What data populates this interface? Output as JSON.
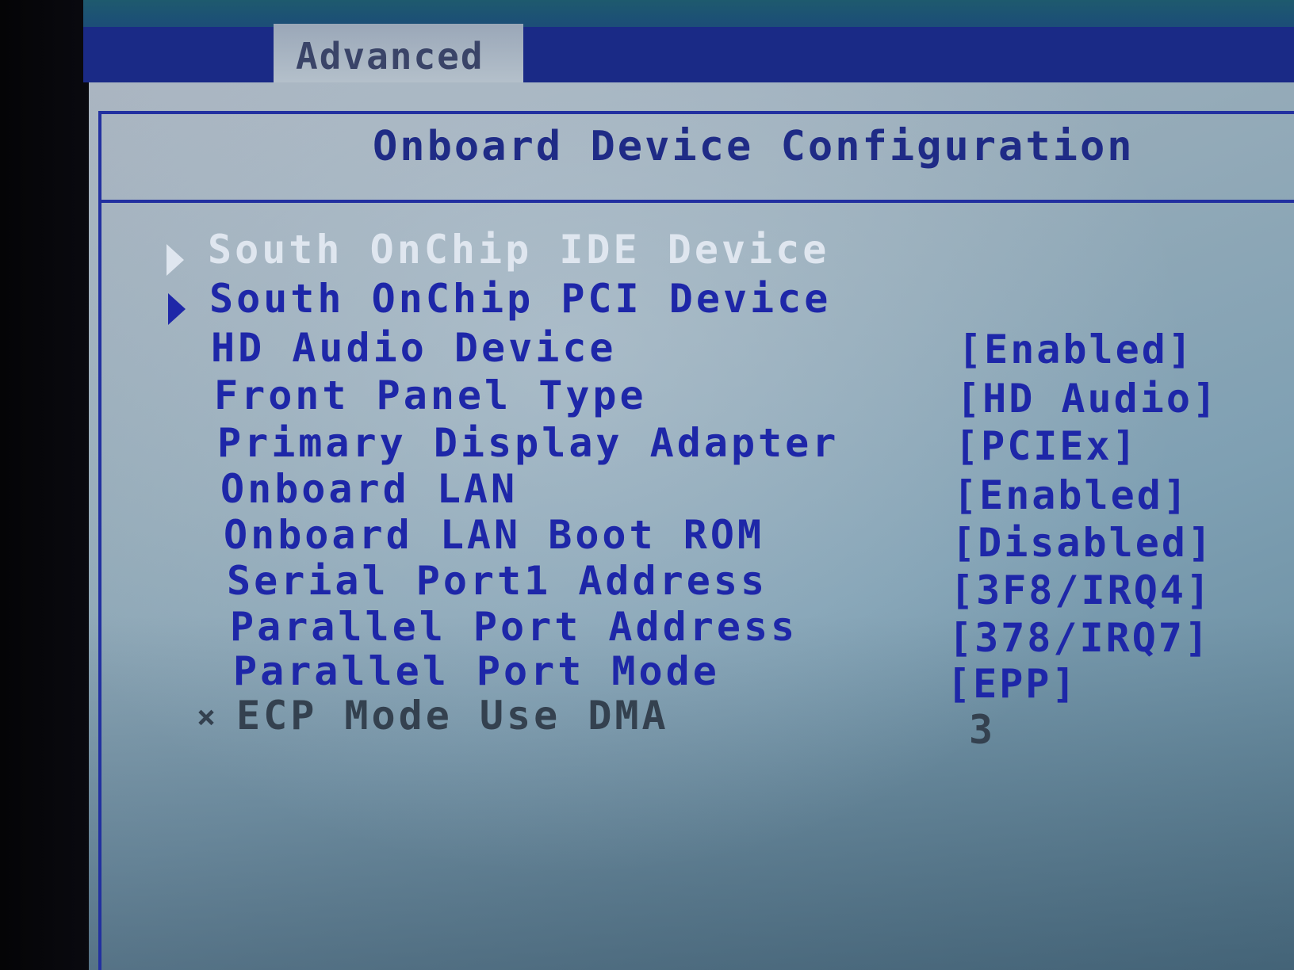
{
  "header": {
    "active_tab": "Advanced"
  },
  "panel": {
    "title": "Onboard Device Configuration"
  },
  "menu": {
    "items": [
      {
        "label": "South OnChip IDE Device",
        "type": "submenu",
        "selected": true
      },
      {
        "label": "South OnChip PCI Device",
        "type": "submenu",
        "selected": false
      },
      {
        "label": "HD Audio Device",
        "value": "[Enabled]"
      },
      {
        "label": "Front Panel Type",
        "value": "[HD Audio]"
      },
      {
        "label": "Primary Display Adapter",
        "value": "[PCIEx]"
      },
      {
        "label": "Onboard LAN",
        "value": "[Enabled]"
      },
      {
        "label": "Onboard LAN Boot ROM",
        "value": "[Disabled]"
      },
      {
        "label": "Serial Port1 Address",
        "value": "[3F8/IRQ4]"
      },
      {
        "label": "Parallel Port Address",
        "value": "[378/IRQ7]"
      },
      {
        "label": "Parallel Port Mode",
        "value": "[EPP]"
      },
      {
        "label": "ECP Mode Use DMA",
        "value": "3",
        "disabled": true,
        "marker": "×"
      }
    ]
  },
  "colors": {
    "item_text": "#1e27a8",
    "selected_text": "#dfe6ef",
    "disabled_text": "#34414f",
    "tabbar": "#1a2a86",
    "panel_bg": "#93aab8"
  },
  "icons": {
    "submenu_marker": "triangle-right-icon",
    "disabled_marker": "x-mark-icon"
  }
}
